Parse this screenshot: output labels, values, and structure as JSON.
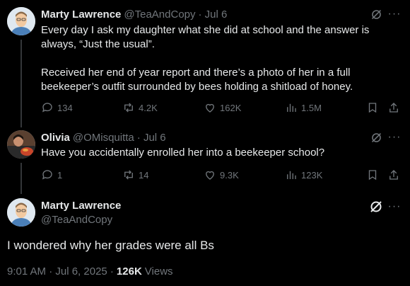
{
  "tweet1": {
    "name": "Marty Lawrence",
    "handle": "@TeaAndCopy",
    "date": "· Jul 6",
    "text": "Every day I ask my daughter what she did at school and the answer is always, “Just the usual”.\n\nReceived her end of year report and there’s a photo of her in a full beekeeper’s outfit surrounded by bees holding a shitload of honey.",
    "replies": "134",
    "reposts": "4.2K",
    "likes": "162K",
    "views": "1.5M"
  },
  "tweet2": {
    "name": "Olivia",
    "handle": "@OMisquitta",
    "date": "· Jul 6",
    "text": "Have you accidentally enrolled her into a beekeeper school?",
    "replies": "1",
    "reposts": "14",
    "likes": "9.3K",
    "views": "123K"
  },
  "tweet3": {
    "name": "Marty Lawrence",
    "handle": "@TeaAndCopy",
    "text": "I wondered why her grades were all Bs",
    "timestamp": "9:01 AM · Jul 6, 2025 ·",
    "views_count": "126K",
    "views_label": "Views"
  },
  "colors": {
    "background": "#000000",
    "text": "#e7e9ea",
    "secondary": "#71767b",
    "line": "#333639"
  },
  "icons": [
    "grok-icon",
    "more-icon",
    "reply-icon",
    "repost-icon",
    "like-icon",
    "views-icon",
    "bookmark-icon",
    "share-icon"
  ]
}
